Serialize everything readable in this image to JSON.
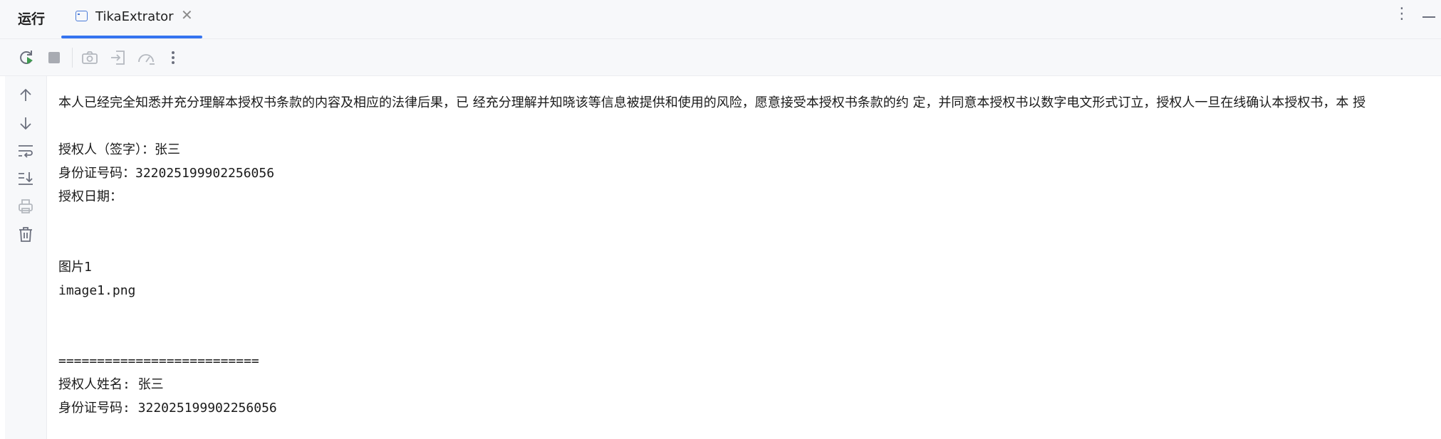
{
  "panel": {
    "title": "运行"
  },
  "tab": {
    "label": "TikaExtrator",
    "close_glyph": "✕",
    "icon": "application-window-icon"
  },
  "window_controls": {
    "more_glyph": "⋮"
  },
  "toolbar": {
    "icons": [
      "rerun-icon",
      "stop-icon",
      "camera-icon",
      "exit-icon",
      "profiler-icon",
      "more-icon"
    ],
    "more_glyph": "⋮"
  },
  "gutter": {
    "icons": [
      "arrow-up-icon",
      "arrow-down-icon",
      "soft-wrap-icon",
      "scroll-to-end-icon",
      "print-icon",
      "trash-icon"
    ]
  },
  "console": {
    "lines": [
      "本人已经完全知悉并充分理解本授权书条款的内容及相应的法律后果，已 经充分理解并知晓该等信息被提供和使用的风险，愿意接受本授权书条款的约 定，并同意本授权书以数字电文形式订立，授权人一旦在线确认本授权书，本 授",
      "授权人（签字）：张三",
      "身份证号码：322025199902256056",
      "授权日期：",
      "图片1",
      "image1.png",
      "==========================",
      "授权人姓名: 张三",
      "身份证号码: 322025199902256056"
    ]
  },
  "colors": {
    "accent": "#3574f0",
    "run_green": "#3e9b4f",
    "icon_gray": "#6c707e",
    "icon_disabled": "#b4b8bf",
    "chrome_background": "#f7f8fa"
  }
}
